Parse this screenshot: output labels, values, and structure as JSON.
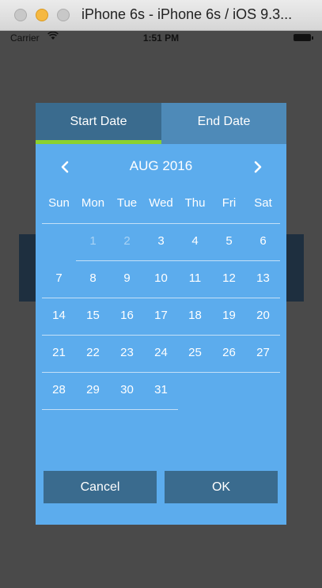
{
  "window": {
    "title": "iPhone 6s - iPhone 6s / iOS 9.3..."
  },
  "status_bar": {
    "carrier": "Carrier",
    "time": "1:51 PM"
  },
  "date_picker": {
    "tabs": [
      {
        "label": "Start Date",
        "selected": true
      },
      {
        "label": "End Date",
        "selected": false
      }
    ],
    "month_label": "AUG 2016",
    "weekdays": [
      "Sun",
      "Mon",
      "Tue",
      "Wed",
      "Thu",
      "Fri",
      "Sat"
    ],
    "weeks": [
      [
        "",
        "1",
        "2",
        "3",
        "4",
        "5",
        "6"
      ],
      [
        "7",
        "8",
        "9",
        "10",
        "11",
        "12",
        "13"
      ],
      [
        "14",
        "15",
        "16",
        "17",
        "18",
        "19",
        "20"
      ],
      [
        "21",
        "22",
        "23",
        "24",
        "25",
        "26",
        "27"
      ],
      [
        "28",
        "29",
        "30",
        "31",
        "",
        "",
        ""
      ]
    ],
    "disabled_days": [
      "1",
      "2"
    ],
    "buttons": {
      "cancel": "Cancel",
      "ok": "OK"
    }
  },
  "colors": {
    "dialog_bg": "#5caced",
    "tab_selected": "#3a6b8e",
    "tab_unselected": "#4e8ab8",
    "tab_indicator": "#8bd12f",
    "button_bg": "#3a6b8e"
  },
  "icons": {
    "prev": "chevron-left-icon",
    "next": "chevron-right-icon",
    "wifi": "wifi-icon",
    "battery": "battery-icon"
  }
}
